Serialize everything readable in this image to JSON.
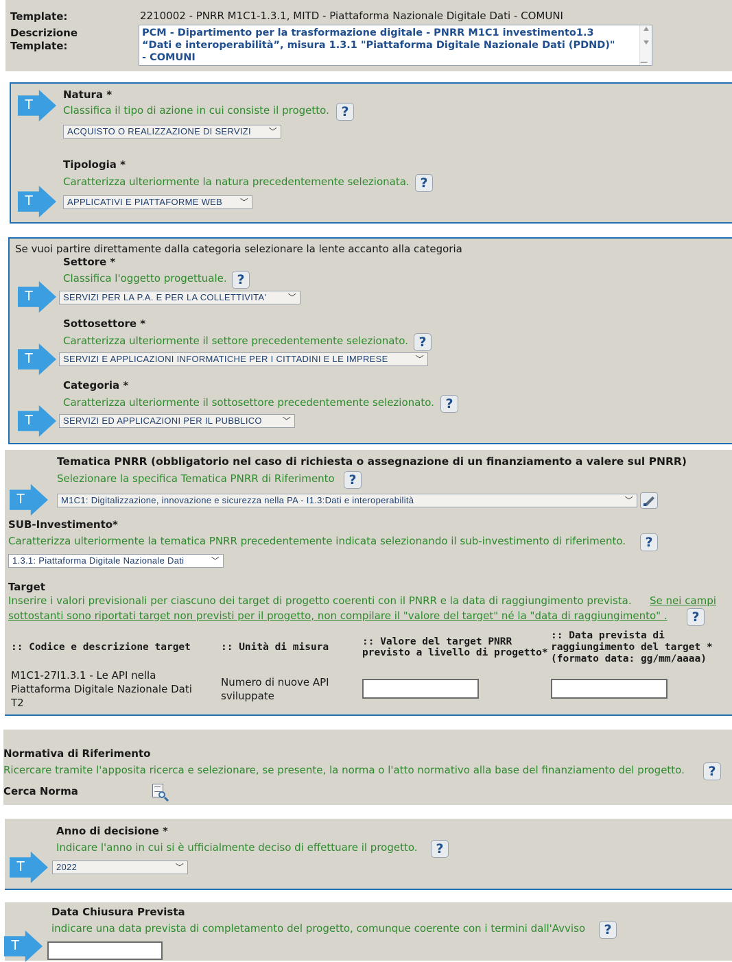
{
  "template": {
    "label": "Template:",
    "value": "2210002 - PNRR M1C1-1.3.1, MITD - Piattaforma Nazionale Digitale Dati - COMUNI",
    "desc_label_1": "Descrizione",
    "desc_label_2": "Template:",
    "desc_line_1": "PCM - Dipartimento per la trasformazione digitale - PNRR M1C1 investimento1.3",
    "desc_line_2": "“Dati e interoperabilità”, misura 1.3.1 \"Piattaforma Digitale Nazionale Dati (PDND)\"",
    "desc_line_3": "- COMUNI"
  },
  "arrow_letter": "T",
  "help_glyph": "?",
  "chevron": "﹀",
  "natura": {
    "label": "Natura *",
    "hint": "Classifica il tipo di azione in cui consiste il progetto.",
    "value": "ACQUISTO O REALIZZAZIONE DI SERVIZI"
  },
  "tipologia": {
    "label": "Tipologia *",
    "hint": "Caratterizza ulteriormente la natura precedentemente selezionata.",
    "value": "APPLICATIVI E PIATTAFORME WEB"
  },
  "category_intro": "Se vuoi partire direttamente dalla categoria selezionare la lente accanto alla categoria",
  "settore": {
    "label": "Settore *",
    "hint": "Classifica l'oggetto progettuale.",
    "value": "SERVIZI PER LA P.A. E PER LA COLLETTIVITA'"
  },
  "sottosettore": {
    "label": "Sottosettore *",
    "hint": "Caratterizza ulteriormente il settore precedentemente selezionato.",
    "value": "SERVIZI E APPLICAZIONI INFORMATICHE PER I CITTADINI E LE IMPRESE"
  },
  "categoria": {
    "label": "Categoria *",
    "hint": "Caratterizza ulteriormente il sottosettore precedentemente selezionato.",
    "value": "SERVIZI ED APPLICAZIONI PER IL PUBBLICO"
  },
  "tematica": {
    "label": "Tematica PNRR (obbligatorio nel caso di richiesta o assegnazione di un finanziamento a valere sul PNRR)",
    "hint": "Selezionare la specifica Tematica PNRR di Riferimento",
    "value": "M1C1: Digitalizzazione, innovazione e sicurezza nella PA - I1.3:Dati e interoperabilità"
  },
  "sub_investimento": {
    "label": "SUB-Investimento*",
    "hint": "Caratterizza ulteriormente la tematica PNRR precedentemente indicata selezionando il sub-investimento di riferimento.",
    "value": "1.3.1: Piattaforma Digitale Nazionale Dati"
  },
  "target": {
    "label": "Target",
    "hint_line_1": "Inserire i valori previsionali per ciascuno dei target di progetto coerenti con il PNRR e la data di raggiungimento prevista.",
    "link_line_1": "Se nei campi",
    "link_line_2": "sottostanti sono riportati target non previsti per il progetto, non compilare il \"valore del target\" né la \"data di raggiungimento\" .",
    "columns": {
      "codice": ":: Codice e descrizione target",
      "unita": ":: Unità di misura",
      "valore_1": ":: Valore del target PNRR",
      "valore_2": "previsto a livello di progetto*",
      "data_1": ":: Data prevista di",
      "data_2": "raggiungimento del target *",
      "data_3": "(formato data: gg/mm/aaaa)"
    },
    "row": {
      "codice_1": "M1C1-27I1.3.1 - Le API nella",
      "codice_2": "Piattaforma Digitale Nazionale Dati",
      "codice_3": "T2",
      "unita_1": "Numero di nuove API",
      "unita_2": "sviluppate",
      "valore": "",
      "data": ""
    }
  },
  "normativa": {
    "label": "Normativa di Riferimento",
    "hint": "Ricercare tramite l'apposita ricerca e selezionare, se presente, la norma o l'atto normativo alla base del finanziamento del progetto.",
    "search_label": "Cerca Norma"
  },
  "anno": {
    "label": "Anno di decisione *",
    "hint": "Indicare l'anno in cui si è ufficialmente deciso di effettuare il progetto.",
    "value": "2022"
  },
  "chiusura": {
    "label": "Data Chiusura Prevista",
    "hint": "indicare una data prevista di completamento del progetto, comunque coerente con i termini dall'Avviso",
    "value": ""
  },
  "colors": {
    "panel": "#d8d5cc",
    "hint_green": "#2d8a2d",
    "border_blue": "#1f6fb2",
    "arrow_blue": "#3a9ee0"
  },
  "icons": [
    "arrow-t-icon",
    "help-icon",
    "chevron-down-icon",
    "pencil-icon",
    "search-document-icon"
  ]
}
